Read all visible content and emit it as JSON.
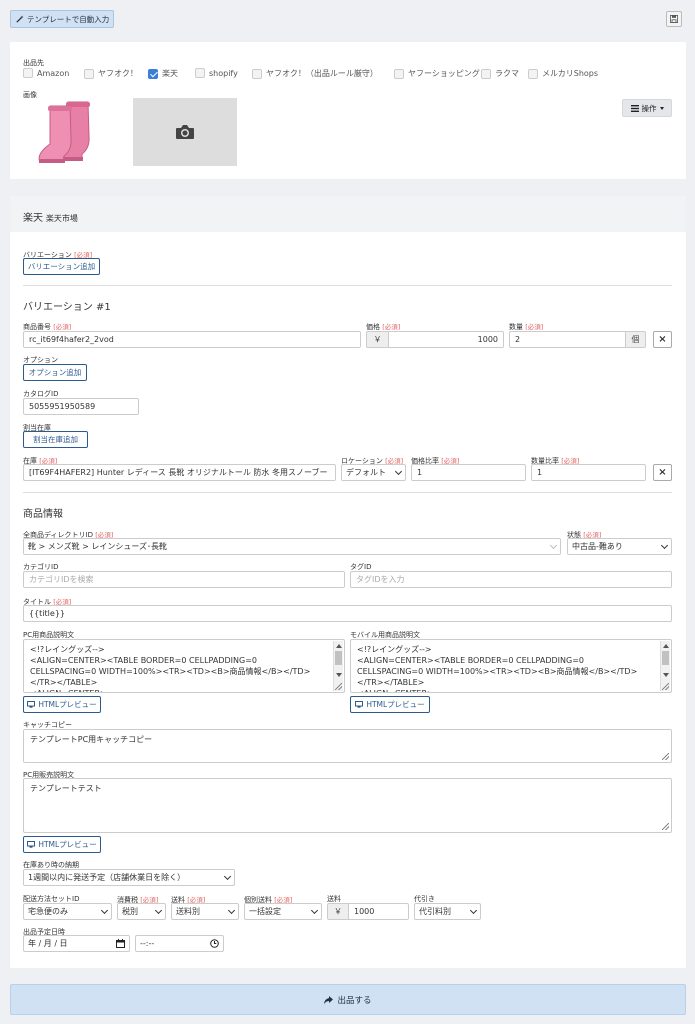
{
  "toolbar": {
    "template_label": "テンプレートで自動入力"
  },
  "section1": {
    "shipto_label": "出品先",
    "marketplaces": [
      {
        "label": "Amazon",
        "checked": false
      },
      {
        "label": "ヤフオク！",
        "checked": false
      },
      {
        "label": "楽天",
        "checked": true
      },
      {
        "label": "shopify",
        "checked": false
      },
      {
        "label": "ヤフオク！（出品ルール厳守）",
        "checked": false
      },
      {
        "label": "ヤフーショッピング",
        "checked": false
      },
      {
        "label": "ラクマ",
        "checked": false
      },
      {
        "label": "メルカリShops",
        "checked": false
      }
    ],
    "image_label": "画像",
    "ops_label": "操作"
  },
  "rakuten": {
    "title": "楽天",
    "subtitle": "楽天市場",
    "required": "[必須]",
    "variation_label": "バリエーション",
    "variation_add": "バリエーション追加",
    "variation_heading": "バリエーション #1",
    "item_no_label": "商品番号",
    "item_no_value": "rc_it69f4hafer2_2vod",
    "price_label": "価格",
    "currency": "￥",
    "price_value": "1000",
    "qty_label": "数量",
    "qty_value": "2",
    "qty_unit": "個",
    "option_label": "オプション",
    "option_add": "オプション追加",
    "catalog_label": "カタログID",
    "catalog_value": "5055951950589",
    "alloc_label": "割当在庫",
    "alloc_add": "割当在庫追加",
    "stock_label": "在庫",
    "stock_value": "[IT69F4HAFER2] Hunter レディース 長靴 オリジナルトール 防水 冬用スノーブー",
    "location_label": "ロケーション",
    "location_value": "デフォルト",
    "price_ratio_label": "価格比率",
    "price_ratio_value": "1",
    "qty_ratio_label": "数量比率",
    "qty_ratio_value": "1"
  },
  "product": {
    "heading": "商品情報",
    "dir_label": "全商品ディレクトリID",
    "dir_value": "靴 > メンズ靴 > レインシューズ･長靴",
    "status_label": "状態",
    "status_value": "中古品-難あり",
    "category_label": "カテゴリID",
    "category_ph": "カテゴリIDを検索",
    "tag_label": "タグID",
    "tag_ph": "タグIDを入力",
    "title_label": "タイトル",
    "title_value": "{{title}}",
    "pc_desc_label": "PC用商品説明文",
    "pc_desc_value": "<!?レイングッズ-->\n<ALIGN=CENTER><TABLE BORDER=0 CELLPADDING=0\nCELLSPACING=0 WIDTH=100%><TR><TD><B>商品情報</B></TD>\n</TR></TABLE>\n<ALIGN=CENTER>",
    "mobile_desc_label": "モバイル用商品説明文",
    "mobile_desc_value": "<!?レイングッズ-->\n<ALIGN=CENTER><TABLE BORDER=0 CELLPADDING=0\nCELLSPACING=0 WIDTH=100%><TR><TD><B>商品情報</B></TD>\n</TR></TABLE>\n<ALIGN=CENTER>",
    "html_preview": "HTMLプレビュー",
    "catch_label": "キャッチコピー",
    "catch_value": "テンプレートPC用キャッチコピー",
    "pc_sales_label": "PC用販売説明文",
    "pc_sales_value": "テンプレートテスト",
    "delivery_label": "在庫あり時の納期",
    "delivery_value": "1週間以内に発送予定（店舗休業日を除く）",
    "shipset_label": "配送方法セットID",
    "shipset_value": "宅急便のみ",
    "tax_label": "消費税",
    "tax_value": "税別",
    "shipfee_label": "送料",
    "shipfee_value": "送料別",
    "indiv_label": "個別送料",
    "indiv_value": "一括設定",
    "shipcost_label": "送料",
    "shipcost_value": "1000",
    "cod_label": "代引き",
    "cod_value": "代引料別",
    "date_label": "出品予定日時",
    "date_ph": "年 / 月 / 日",
    "time_ph": "--:--"
  },
  "submit_label": "出品する"
}
